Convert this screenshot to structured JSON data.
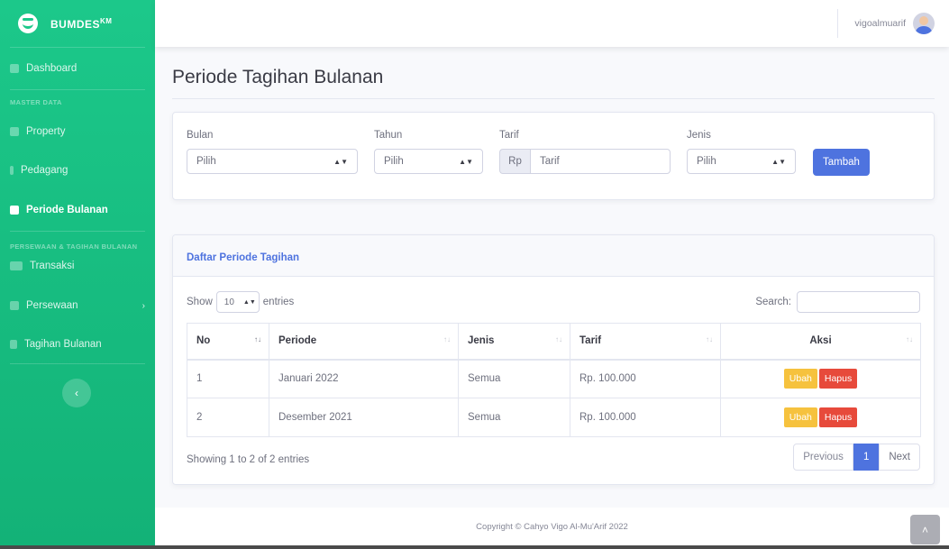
{
  "brand": {
    "name": "BUMDES",
    "sup": "KM"
  },
  "sidebar": {
    "dashboard": "Dashboard",
    "heading_master": "MASTER DATA",
    "property": "Property",
    "pedagang": "Pedagang",
    "periode": "Periode Bulanan",
    "heading_sewa": "PERSEWAAN & TAGIHAN BULANAN",
    "transaksi": "Transaksi",
    "persewaan": "Persewaan",
    "tagihan": "Tagihan Bulanan"
  },
  "topbar": {
    "username": "vigoalmuarif"
  },
  "page": {
    "title": "Periode Tagihan Bulanan"
  },
  "filter": {
    "bulan_label": "Bulan",
    "bulan_value": "Pilih",
    "tahun_label": "Tahun",
    "tahun_value": "Pilih",
    "tarif_label": "Tarif",
    "tarif_prefix": "Rp",
    "tarif_placeholder": "Tarif",
    "jenis_label": "Jenis",
    "jenis_value": "Pilih",
    "submit": "Tambah"
  },
  "table_card": {
    "title": "Daftar Periode Tagihan",
    "show": "Show",
    "entries_value": "10",
    "entries": "entries",
    "search": "Search:",
    "headers": [
      "No",
      "Periode",
      "Jenis",
      "Tarif",
      "Aksi"
    ],
    "rows": [
      {
        "no": "1",
        "periode": "Januari 2022",
        "jenis": "Semua",
        "tarif": "Rp. 100.000"
      },
      {
        "no": "2",
        "periode": "Desember 2021",
        "jenis": "Semua",
        "tarif": "Rp. 100.000"
      }
    ],
    "edit": "Ubah",
    "delete": "Hapus",
    "info": "Showing 1 to 2 of 2 entries",
    "prev": "Previous",
    "page": "1",
    "next": "Next"
  },
  "footer": {
    "copyright": "Copyright © Cahyo Vigo Al-Mu'Arif 2022"
  },
  "colors": {
    "sidebar": "#1cc88a",
    "primary": "#4e73df",
    "warning": "#f6c23e",
    "danger": "#e74a3b"
  }
}
